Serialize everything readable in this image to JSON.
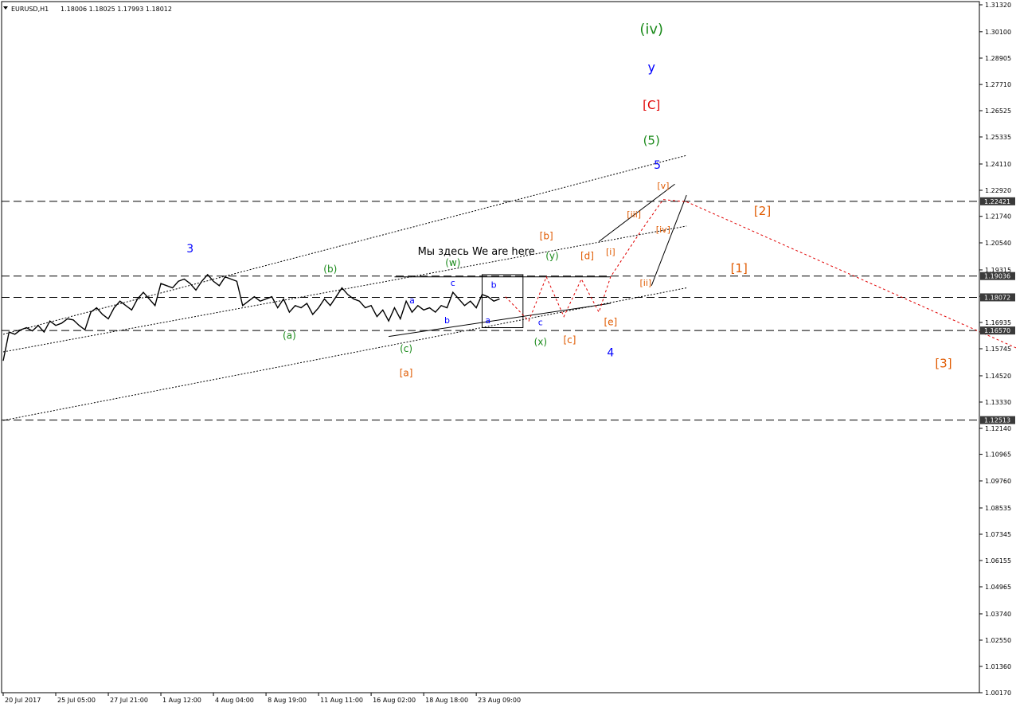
{
  "header": {
    "symbol": "EURUSD,H1",
    "ohlc": "1.18006 1.18025 1.17993 1.18012"
  },
  "colors": {
    "candles": "#000000",
    "grid_lines": "#000000",
    "wave_blue": "#0000ff",
    "wave_green": "#1a8a1a",
    "wave_red": "#e00000",
    "wave_orange": "#e05a00",
    "forecast": "#e00000",
    "price_tag": "#3a3a3a"
  },
  "chart_data": {
    "type": "line",
    "title": "EURUSD,H1",
    "x_tick_labels": [
      "20 Jul 2017",
      "25 Jul 05:00",
      "27 Jul 21:00",
      "1 Aug 12:00",
      "4 Aug 04:00",
      "8 Aug 19:00",
      "11 Aug 11:00",
      "16 Aug 02:00",
      "18 Aug 18:00",
      "23 Aug 09:00"
    ],
    "y_tick_labels": [
      "1.31320",
      "1.30100",
      "1.28905",
      "1.27710",
      "1.26525",
      "1.25335",
      "1.24110",
      "1.22920",
      "1.21740",
      "1.20540",
      "1.19315",
      "1.18120",
      "1.16935",
      "1.15745",
      "1.14520",
      "1.13330",
      "1.12140",
      "1.10965",
      "1.09760",
      "1.08535",
      "1.07345",
      "1.06155",
      "1.04965",
      "1.03740",
      "1.02550",
      "1.01360",
      "1.00170"
    ],
    "ylim": [
      1.0017,
      1.3132
    ],
    "price_levels": [
      "1.22421",
      "1.19036",
      "1.18072",
      "1.16570",
      "1.12513"
    ],
    "price": [
      [
        0,
        1.152
      ],
      [
        1,
        1.165
      ],
      [
        2,
        1.164
      ],
      [
        3,
        1.166
      ],
      [
        4,
        1.167
      ],
      [
        5,
        1.1655
      ],
      [
        6,
        1.168
      ],
      [
        7,
        1.165
      ],
      [
        8,
        1.17
      ],
      [
        9,
        1.168
      ],
      [
        10,
        1.169
      ],
      [
        11,
        1.171
      ],
      [
        12,
        1.1705
      ],
      [
        13,
        1.168
      ],
      [
        14,
        1.166
      ],
      [
        15,
        1.174
      ],
      [
        16,
        1.176
      ],
      [
        17,
        1.173
      ],
      [
        18,
        1.171
      ],
      [
        19,
        1.176
      ],
      [
        20,
        1.179
      ],
      [
        21,
        1.177
      ],
      [
        22,
        1.175
      ],
      [
        23,
        1.18
      ],
      [
        24,
        1.183
      ],
      [
        25,
        1.18
      ],
      [
        26,
        1.177
      ],
      [
        27,
        1.187
      ],
      [
        28,
        1.186
      ],
      [
        29,
        1.185
      ],
      [
        30,
        1.188
      ],
      [
        31,
        1.189
      ],
      [
        32,
        1.187
      ],
      [
        33,
        1.184
      ],
      [
        34,
        1.188
      ],
      [
        35,
        1.191
      ],
      [
        36,
        1.188
      ],
      [
        37,
        1.186
      ],
      [
        38,
        1.19
      ],
      [
        39,
        1.189
      ],
      [
        40,
        1.188
      ],
      [
        41,
        1.177
      ],
      [
        42,
        1.179
      ],
      [
        43,
        1.181
      ],
      [
        44,
        1.179
      ],
      [
        45,
        1.18
      ],
      [
        46,
        1.181
      ],
      [
        47,
        1.176
      ],
      [
        48,
        1.18
      ],
      [
        49,
        1.174
      ],
      [
        50,
        1.177
      ],
      [
        51,
        1.176
      ],
      [
        52,
        1.178
      ],
      [
        53,
        1.173
      ],
      [
        54,
        1.176
      ],
      [
        55,
        1.18
      ],
      [
        56,
        1.177
      ],
      [
        57,
        1.181
      ],
      [
        58,
        1.185
      ],
      [
        59,
        1.182
      ],
      [
        60,
        1.18
      ],
      [
        61,
        1.179
      ],
      [
        62,
        1.176
      ],
      [
        63,
        1.177
      ],
      [
        64,
        1.172
      ],
      [
        65,
        1.175
      ],
      [
        66,
        1.17
      ],
      [
        67,
        1.176
      ],
      [
        68,
        1.171
      ],
      [
        69,
        1.179
      ],
      [
        70,
        1.174
      ],
      [
        71,
        1.177
      ],
      [
        72,
        1.175
      ],
      [
        73,
        1.176
      ],
      [
        74,
        1.174
      ],
      [
        75,
        1.177
      ],
      [
        76,
        1.176
      ],
      [
        77,
        1.183
      ],
      [
        78,
        1.18
      ],
      [
        79,
        1.177
      ],
      [
        80,
        1.179
      ],
      [
        81,
        1.176
      ],
      [
        82,
        1.182
      ],
      [
        83,
        1.181
      ],
      [
        84,
        1.179
      ],
      [
        85,
        1.18
      ]
    ],
    "x_range": [
      0,
      117
    ],
    "x_tick_positions": [
      0,
      9,
      18,
      27,
      36,
      45,
      54,
      63,
      72,
      81
    ],
    "trendlines": [
      {
        "style": "dotted",
        "color": "#000000",
        "from": [
          0,
          1.164
        ],
        "to": [
          117,
          1.245
        ]
      },
      {
        "style": "dotted",
        "color": "#000000",
        "from": [
          0,
          1.156
        ],
        "to": [
          117,
          1.213
        ]
      },
      {
        "style": "dotted",
        "color": "#000000",
        "from": [
          0,
          1.125
        ],
        "to": [
          117,
          1.185
        ]
      },
      {
        "style": "solid",
        "color": "#000000",
        "from": [
          67,
          1.19
        ],
        "to": [
          104,
          1.19
        ]
      },
      {
        "style": "solid",
        "color": "#000000",
        "from": [
          66,
          1.163
        ],
        "to": [
          104,
          1.178
        ]
      },
      {
        "style": "solid",
        "color": "#000000",
        "from": [
          102,
          1.206
        ],
        "to": [
          115,
          1.232
        ]
      },
      {
        "style": "solid",
        "color": "#000000",
        "from": [
          111,
          1.186
        ],
        "to": [
          117,
          1.227
        ]
      }
    ],
    "forecast_paths": [
      {
        "color": "#e00000",
        "points": [
          [
            86,
            1.181
          ],
          [
            90,
            1.17
          ],
          [
            93,
            1.19
          ],
          [
            96,
            1.172
          ],
          [
            99,
            1.189
          ],
          [
            102,
            1.174
          ],
          [
            104,
            1.19
          ],
          [
            109,
            1.21
          ],
          [
            113,
            1.225
          ],
          [
            117,
            1.224
          ]
        ]
      },
      {
        "color": "#e00000",
        "points": [
          [
            117,
            1.224
          ],
          [
            175,
            1.156
          ]
        ]
      }
    ],
    "annotations": [
      {
        "text": "(iv)",
        "x": 111,
        "y": 1.3,
        "color": "#1a8a1a",
        "size": 18
      },
      {
        "text": "y",
        "x": 111,
        "y": 1.283,
        "color": "#0000ff",
        "size": 16
      },
      {
        "text": "[C]",
        "x": 111,
        "y": 1.266,
        "color": "#e00000",
        "size": 15
      },
      {
        "text": "(5)",
        "x": 111,
        "y": 1.25,
        "color": "#1a8a1a",
        "size": 15
      },
      {
        "text": "5",
        "x": 112,
        "y": 1.239,
        "color": "#0000ff",
        "size": 14
      },
      {
        "text": "[v]",
        "x": 113,
        "y": 1.23,
        "color": "#e05a00",
        "size": 11
      },
      {
        "text": "[iii]",
        "x": 108,
        "y": 1.217,
        "color": "#e05a00",
        "size": 11
      },
      {
        "text": "[iv]",
        "x": 113,
        "y": 1.21,
        "color": "#e05a00",
        "size": 11
      },
      {
        "text": "[i]",
        "x": 104,
        "y": 1.2,
        "color": "#e05a00",
        "size": 11
      },
      {
        "text": "[ii]",
        "x": 110,
        "y": 1.186,
        "color": "#e05a00",
        "size": 11
      },
      {
        "text": "[2]",
        "x": 130,
        "y": 1.218,
        "color": "#e05a00",
        "size": 15
      },
      {
        "text": "[1]",
        "x": 126,
        "y": 1.192,
        "color": "#e05a00",
        "size": 15
      },
      {
        "text": "[3]",
        "x": 161,
        "y": 1.149,
        "color": "#e05a00",
        "size": 15
      },
      {
        "text": "3",
        "x": 32,
        "y": 1.201,
        "color": "#0000ff",
        "size": 14
      },
      {
        "text": "(b)",
        "x": 56,
        "y": 1.192,
        "color": "#1a8a1a",
        "size": 12
      },
      {
        "text": "(a)",
        "x": 49,
        "y": 1.162,
        "color": "#1a8a1a",
        "size": 12
      },
      {
        "text": "(c)",
        "x": 69,
        "y": 1.156,
        "color": "#1a8a1a",
        "size": 12
      },
      {
        "text": "[a]",
        "x": 69,
        "y": 1.145,
        "color": "#e05a00",
        "size": 12
      },
      {
        "text": "a",
        "x": 70,
        "y": 1.178,
        "color": "#0000ff",
        "size": 11
      },
      {
        "text": "b",
        "x": 76,
        "y": 1.169,
        "color": "#0000ff",
        "size": 11
      },
      {
        "text": "c",
        "x": 77,
        "y": 1.186,
        "color": "#0000ff",
        "size": 11
      },
      {
        "text": "(w)",
        "x": 77,
        "y": 1.195,
        "color": "#1a8a1a",
        "size": 12
      },
      {
        "text": "a",
        "x": 83,
        "y": 1.169,
        "color": "#0000ff",
        "size": 11
      },
      {
        "text": "b",
        "x": 84,
        "y": 1.185,
        "color": "#0000ff",
        "size": 11
      },
      {
        "text": "c",
        "x": 92,
        "y": 1.168,
        "color": "#0000ff",
        "size": 11
      },
      {
        "text": "(x)",
        "x": 92,
        "y": 1.159,
        "color": "#1a8a1a",
        "size": 12
      },
      {
        "text": "[c]",
        "x": 97,
        "y": 1.16,
        "color": "#e05a00",
        "size": 12
      },
      {
        "text": "[b]",
        "x": 93,
        "y": 1.207,
        "color": "#e05a00",
        "size": 12
      },
      {
        "text": "(y)",
        "x": 94,
        "y": 1.198,
        "color": "#1a8a1a",
        "size": 12
      },
      {
        "text": "[d]",
        "x": 100,
        "y": 1.198,
        "color": "#e05a00",
        "size": 12
      },
      {
        "text": "[e]",
        "x": 104,
        "y": 1.168,
        "color": "#e05a00",
        "size": 12
      },
      {
        "text": "4",
        "x": 104,
        "y": 1.154,
        "color": "#0000ff",
        "size": 14
      },
      {
        "text": "Мы здесь We are here",
        "x": 81,
        "y": 1.2,
        "color": "#000000",
        "size": 13
      }
    ]
  }
}
